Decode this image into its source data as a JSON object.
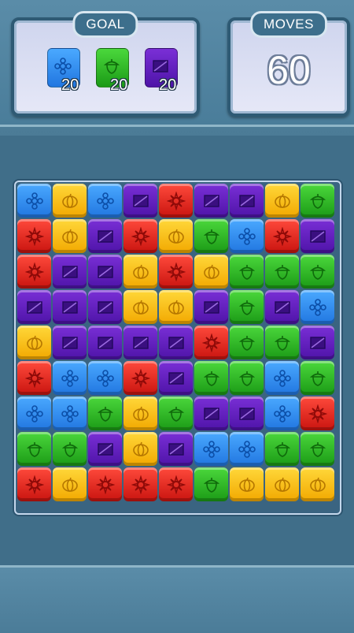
{
  "goal": {
    "title": "GOAL",
    "items": [
      {
        "kind": "blue",
        "icon": "flower-icon",
        "count": "20"
      },
      {
        "kind": "green",
        "icon": "acorn-icon",
        "count": "20"
      },
      {
        "kind": "purple",
        "icon": "square-slash-icon",
        "count": "20"
      }
    ]
  },
  "moves": {
    "title": "MOVES",
    "value": "60"
  },
  "board": {
    "rows": 9,
    "cols": 9,
    "tiles": [
      [
        "blue",
        "yellow",
        "blue",
        "purple",
        "red",
        "purple",
        "purple",
        "yellow",
        "green"
      ],
      [
        "red",
        "yellow",
        "purple",
        "red",
        "yellow",
        "green",
        "blue",
        "red",
        "purple"
      ],
      [
        "red",
        "purple",
        "purple",
        "yellow",
        "red",
        "yellow",
        "green",
        "green",
        "green"
      ],
      [
        "purple",
        "purple",
        "purple",
        "yellow",
        "yellow",
        "purple",
        "green",
        "purple",
        "blue"
      ],
      [
        "yellow",
        "purple",
        "purple",
        "purple",
        "purple",
        "red",
        "green",
        "green",
        "purple"
      ],
      [
        "red",
        "blue",
        "blue",
        "red",
        "purple",
        "green",
        "green",
        "blue",
        "green"
      ],
      [
        "blue",
        "blue",
        "green",
        "yellow",
        "green",
        "purple",
        "purple",
        "blue",
        "red"
      ],
      [
        "green",
        "green",
        "purple",
        "yellow",
        "purple",
        "blue",
        "blue",
        "green",
        "green"
      ],
      [
        "red",
        "yellow",
        "red",
        "red",
        "red",
        "green",
        "yellow",
        "yellow",
        "yellow"
      ]
    ]
  },
  "colors": {
    "blue": "#2f8cf0",
    "yellow": "#f7be18",
    "purple": "#5f1fc0",
    "red": "#e02820",
    "green": "#2fbb26"
  },
  "icons": {
    "blue": "flower-icon",
    "yellow": "pumpkin-icon",
    "purple": "square-slash-icon",
    "red": "sunflower-icon",
    "green": "acorn-icon"
  }
}
